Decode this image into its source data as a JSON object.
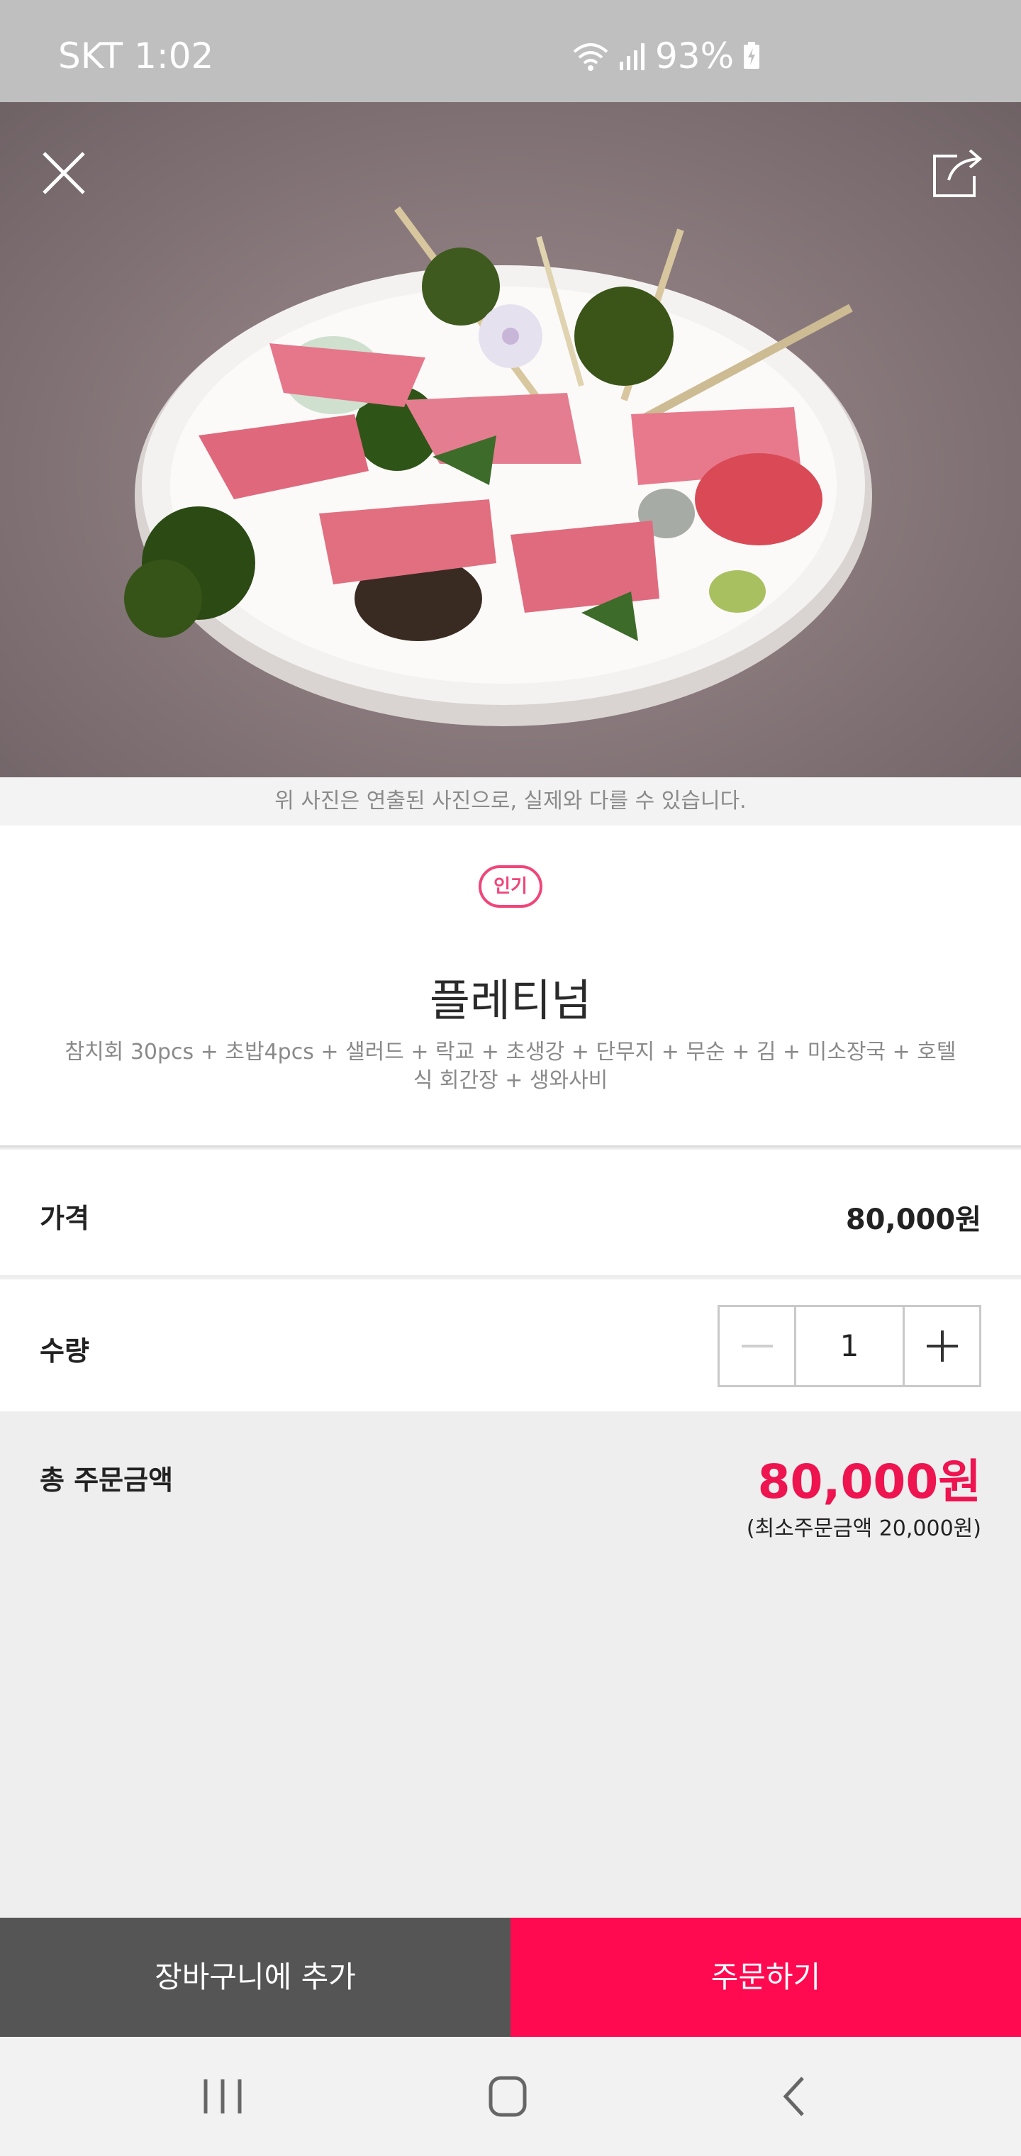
{
  "status_bar": {
    "carrier_time": "SKT 1:02",
    "battery": "93%"
  },
  "hero": {
    "close_icon": "close-icon",
    "share_icon": "share-icon"
  },
  "photo_note": "위 사진은 연출된 사진으로, 실제와 다를 수 있습니다.",
  "product": {
    "badge": "인기",
    "name": "플레티넘",
    "description": "참치회 30pcs + 초밥4pcs + 샐러드 + 락교 + 초생강 + 단무지 + 무순 + 김 + 미소장국 + 호텔식 회간장 + 생와사비"
  },
  "price_row": {
    "label": "가격",
    "value": "80,000원"
  },
  "qty_row": {
    "label": "수량",
    "value": "1"
  },
  "total": {
    "label": "총 주문금액",
    "value": "80,000원",
    "minimum": "(최소주문금액 20,000원)"
  },
  "buttons": {
    "cart": "장바구니에 추가",
    "order": "주문하기"
  },
  "colors": {
    "accent": "#ff0a50",
    "badge": "#f0467a",
    "cart_button": "#555555"
  }
}
